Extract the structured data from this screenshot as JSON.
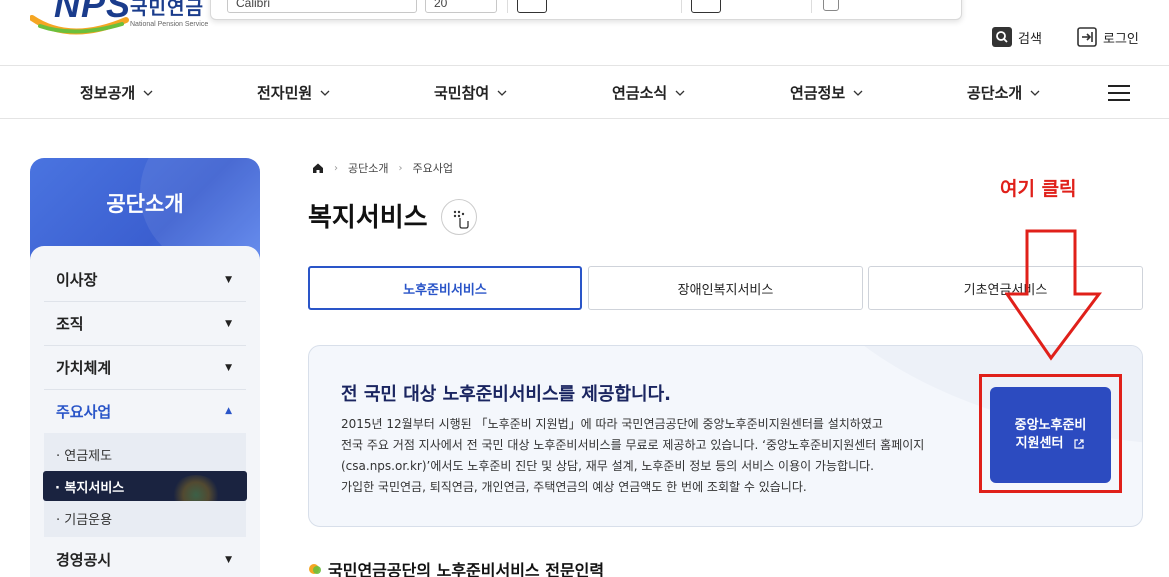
{
  "header": {
    "logo_mark": "NPS",
    "logo_kr": "국민연금",
    "logo_en": "National Pension Service",
    "toolbar": {
      "font_name": "Calibri",
      "font_size": "20"
    },
    "utility": [
      {
        "label": "검색",
        "icon": "search-icon"
      },
      {
        "label": "로그인",
        "icon": "login-icon"
      }
    ]
  },
  "gnb": {
    "items": [
      "정보공개",
      "전자민원",
      "국민참여",
      "연금소식",
      "연금정보",
      "공단소개"
    ]
  },
  "sidebar": {
    "title": "공단소개",
    "items": [
      "이사장",
      "조직",
      "가치체계",
      "주요사업",
      "경영공시"
    ],
    "active_item": "주요사업",
    "sub_items": [
      "· 연금제도",
      "· 복지서비스",
      "· 기금운용"
    ],
    "active_sub": "· 복지서비스"
  },
  "breadcrumb": [
    "공단소개",
    "주요사업"
  ],
  "page": {
    "title": "복지서비스",
    "tabs": [
      "노후준비서비스",
      "장애인복지서비스",
      "기초연금서비스"
    ],
    "active_tab": "노후준비서비스"
  },
  "info": {
    "heading": "전 국민 대상 노후준비서비스를 제공합니다.",
    "lines": [
      "2015년 12월부터 시행된 「노후준비 지원법」에 따라 국민연금공단에 중앙노후준비지원센터를 설치하였고",
      "전국 주요 거점 지사에서 전 국민 대상 노후준비서비스를 무료로 제공하고 있습니다. ‘중앙노후준비지원센터 홈페이지",
      "(csa.nps.or.kr)’에서도 노후준비 진단 및 상담, 재무 설계, 노후준비 정보 등의 서비스 이용이 가능합니다.",
      "가입한 국민연금, 퇴직연금, 개인연금, 주택연금의 예상 연금액도 한 번에 조회할 수 있습니다."
    ],
    "cta_line1": "중앙노후준비",
    "cta_line2": "지원센터"
  },
  "section": {
    "title": "국민연금공단의 노후준비서비스 전문인력"
  },
  "annotation": {
    "text": "여기 클릭",
    "color": "#e0201a"
  },
  "colors": {
    "brand_blue": "#2a55c8",
    "cta_blue": "#2c4bc0",
    "nav_dark": "#1a2340"
  }
}
